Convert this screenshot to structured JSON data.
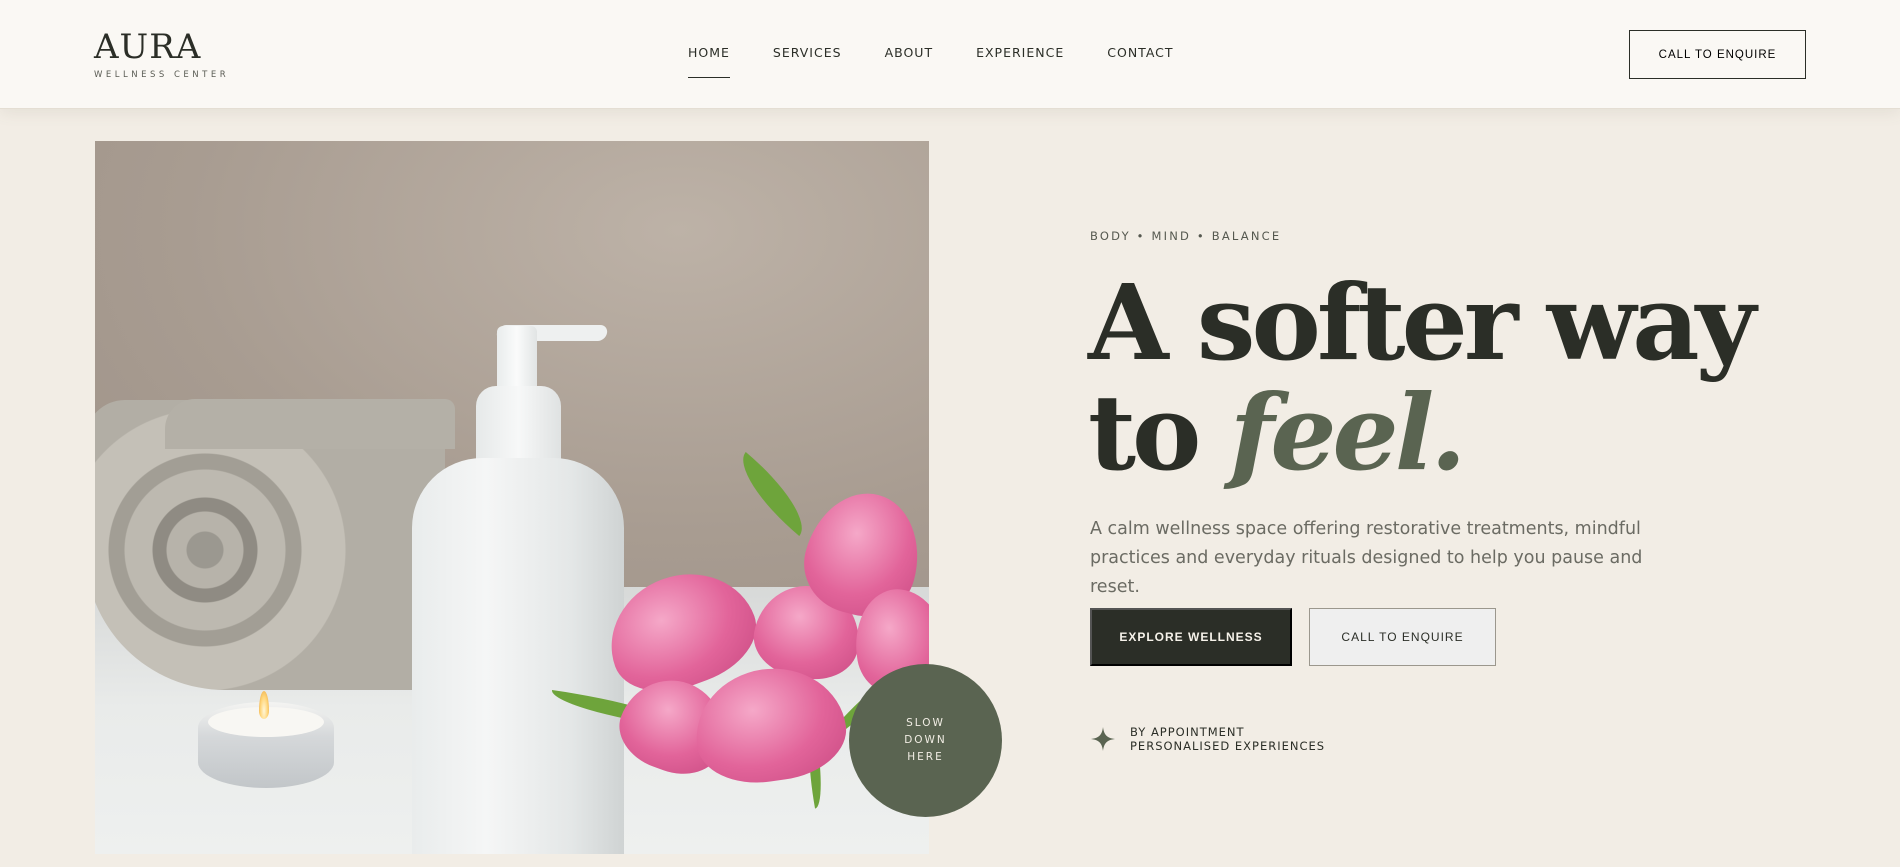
{
  "brand": {
    "name": "AURA",
    "tagline": "WELLNESS CENTER"
  },
  "nav": {
    "items": [
      {
        "label": "HOME",
        "active": true
      },
      {
        "label": "SERVICES",
        "active": false
      },
      {
        "label": "ABOUT",
        "active": false
      },
      {
        "label": "EXPERIENCE",
        "active": false
      },
      {
        "label": "CONTACT",
        "active": false
      }
    ],
    "cta_label": "CALL TO ENQUIRE"
  },
  "hero": {
    "badge": {
      "line1": "SLOW",
      "line2": "DOWN",
      "line3": "HERE"
    },
    "eyebrow": "BODY • MIND • BALANCE",
    "headline_part1": "A softer way",
    "headline_part2": "to ",
    "headline_accent": "feel.",
    "lede": "A calm wellness space offering restorative treatments, mindful practices and everyday rituals designed to help you pause and reset.",
    "primary_button": "EXPLORE WELLNESS",
    "secondary_button": "CALL TO ENQUIRE",
    "appointment": {
      "icon": "sparkle-icon",
      "line1": "BY APPOINTMENT",
      "line2": "PERSONALISED EXPERIENCES"
    }
  },
  "colors": {
    "background": "#f2ede5",
    "header": "#faf8f4",
    "text": "#2b2e27",
    "accent": "#5a6451",
    "muted": "#6b6b63"
  }
}
